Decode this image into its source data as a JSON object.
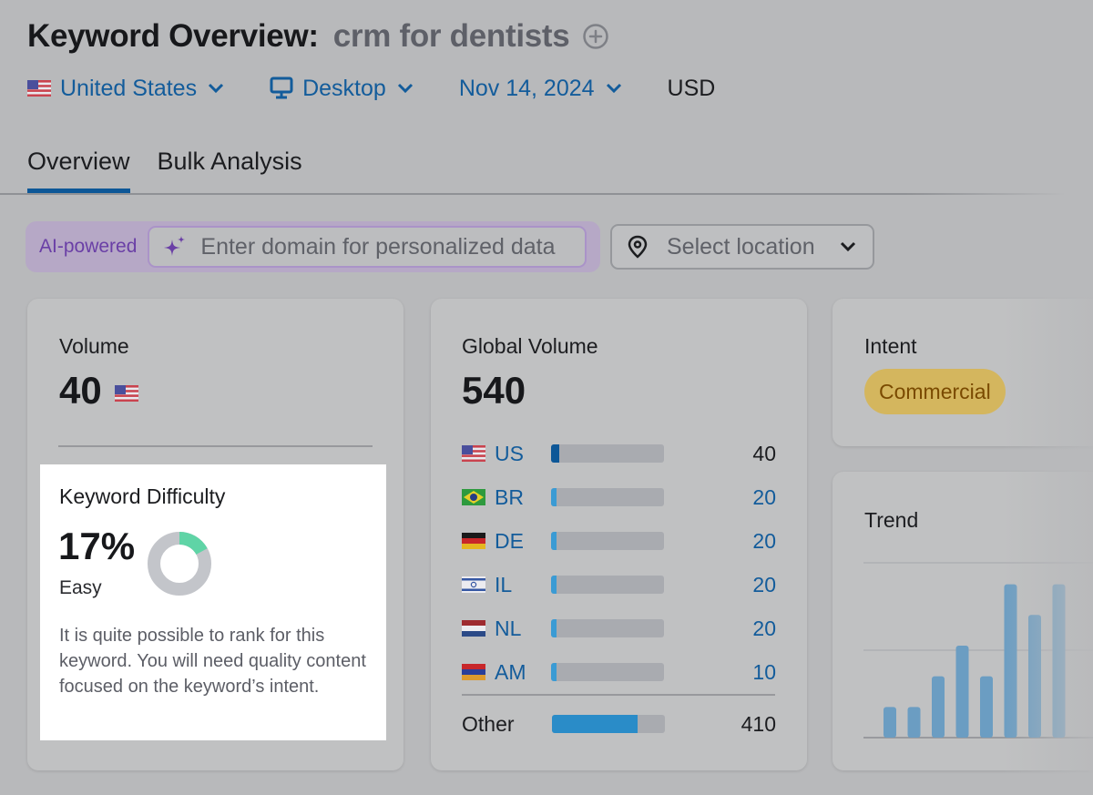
{
  "header": {
    "title": "Keyword Overview:",
    "keyword": "crm for dentists",
    "add_icon": "plus-circle-icon"
  },
  "filters": {
    "country": "United States",
    "device": "Desktop",
    "date": "Nov 14, 2024",
    "currency": "USD"
  },
  "tabs": [
    {
      "label": "Overview",
      "active": true
    },
    {
      "label": "Bulk Analysis",
      "active": false
    }
  ],
  "ai_bar": {
    "badge": "AI-powered",
    "placeholder": "Enter domain for personalized data",
    "value": "",
    "location_placeholder": "Select location"
  },
  "volume": {
    "label": "Volume",
    "value": "40",
    "flag": "us-flag"
  },
  "keyword_difficulty": {
    "label": "Keyword Difficulty",
    "value": "17%",
    "percent": 17,
    "level": "Easy",
    "description": "It is quite possible to rank for this keyword. You will need quality content focused on the keyword’s intent.",
    "color": "#5fd4a6",
    "track_color": "#c3c5ca"
  },
  "global_volume": {
    "label": "Global Volume",
    "value": "540",
    "countries": [
      {
        "code": "US",
        "flag": "us",
        "value": "40",
        "share": 0.074,
        "fill": "#0d5797",
        "linked": false
      },
      {
        "code": "BR",
        "flag": "br",
        "value": "20",
        "share": 0.037,
        "fill": "#3b9bd4",
        "linked": true
      },
      {
        "code": "DE",
        "flag": "de",
        "value": "20",
        "share": 0.037,
        "fill": "#3b9bd4",
        "linked": true
      },
      {
        "code": "IL",
        "flag": "il",
        "value": "20",
        "share": 0.037,
        "fill": "#3b9bd4",
        "linked": true
      },
      {
        "code": "NL",
        "flag": "nl",
        "value": "20",
        "share": 0.037,
        "fill": "#3b9bd4",
        "linked": true
      },
      {
        "code": "AM",
        "flag": "am",
        "value": "10",
        "share": 0.019,
        "fill": "#3b9bd4",
        "linked": true
      }
    ],
    "other": {
      "label": "Other",
      "value": "410",
      "share": 0.76,
      "fill": "#2a8cc8"
    }
  },
  "intent": {
    "label": "Intent",
    "badge": "Commercial",
    "badge_color": "#d4b65e"
  },
  "trend": {
    "label": "Trend",
    "values": [
      10,
      10,
      20,
      30,
      20,
      50,
      40,
      50
    ],
    "max": 57,
    "bar_color": "#6b9dc2"
  },
  "chart_data": [
    {
      "type": "pie",
      "title": "Keyword Difficulty",
      "values": [
        17,
        83
      ],
      "categories": [
        "difficulty",
        "remaining"
      ]
    },
    {
      "type": "bar",
      "title": "Trend",
      "categories": [
        "1",
        "2",
        "3",
        "4",
        "5",
        "6",
        "7",
        "8"
      ],
      "values": [
        10,
        10,
        20,
        30,
        20,
        50,
        40,
        50
      ],
      "xlabel": "",
      "ylabel": ""
    }
  ]
}
